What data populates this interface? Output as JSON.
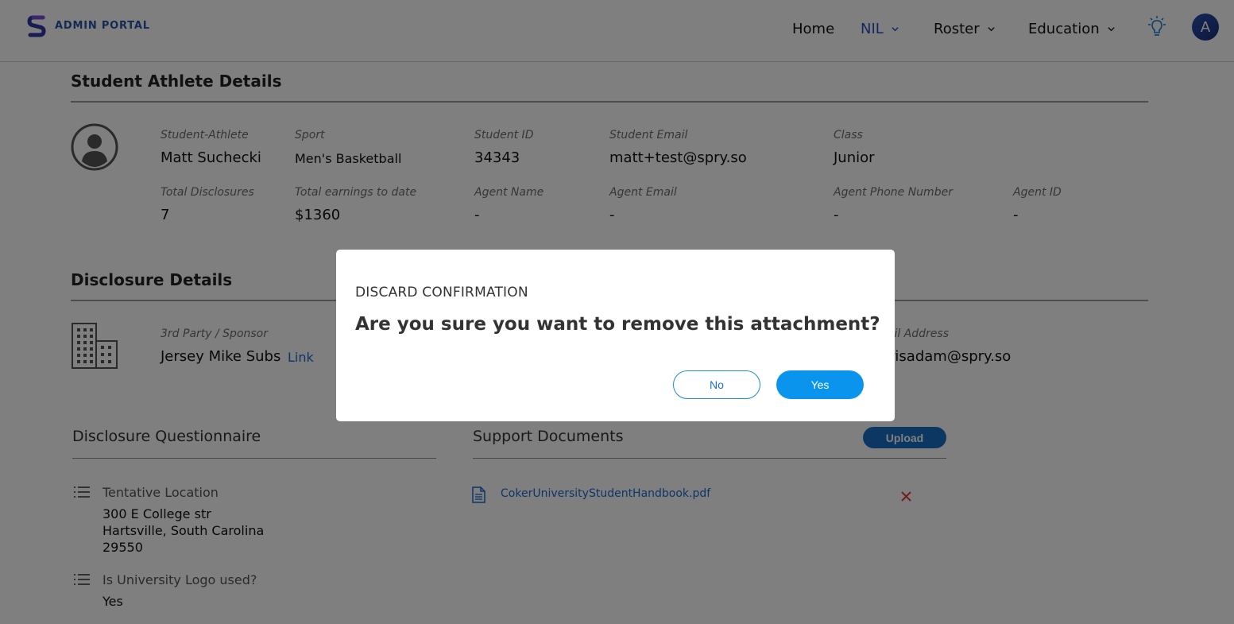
{
  "header": {
    "brand": "ADMIN PORTAL",
    "nav": [
      {
        "label": "Home",
        "has_dropdown": false,
        "active": false
      },
      {
        "label": "NIL",
        "has_dropdown": true,
        "active": true
      },
      {
        "label": "Roster",
        "has_dropdown": true,
        "active": false
      },
      {
        "label": "Education",
        "has_dropdown": true,
        "active": false
      }
    ],
    "avatar_initial": "A",
    "icons": {
      "bulb": "lightbulb-icon",
      "logo": "spry-logo-icon"
    }
  },
  "athlete": {
    "title": "Student Athlete Details",
    "fields": [
      {
        "label": "Student-Athlete",
        "value": "Matt Suchecki"
      },
      {
        "label": "Sport",
        "value": "Men's Basketball"
      },
      {
        "label": "Student ID",
        "value": "34343"
      },
      {
        "label": "Student Email",
        "value": "matt+test@spry.so"
      },
      {
        "label": "Class",
        "value": "Junior"
      },
      {
        "label": "Total Disclosures",
        "value": "7"
      },
      {
        "label": "Total earnings to date",
        "value": "$1360"
      },
      {
        "label": "Agent Name",
        "value": "-"
      },
      {
        "label": "Agent Email",
        "value": "-"
      },
      {
        "label": "Agent Phone Number",
        "value": "-"
      },
      {
        "label": "Agent ID",
        "value": "-"
      }
    ]
  },
  "disclosure": {
    "title": "Disclosure Details",
    "sponsor_label": "3rd Party / Sponsor",
    "sponsor_value": "Jersey Mike Subs",
    "sponsor_link": "Link",
    "email_label_partial": "nail Address",
    "email_value_partial": "arisadam@spry.so"
  },
  "questionnaire": {
    "title": "Disclosure Questionnaire",
    "items": [
      {
        "question": "Tentative Location",
        "answer_lines": [
          "300 E College str",
          "Hartsville, South Carolina",
          "29550"
        ]
      },
      {
        "question": "Is University Logo used?",
        "answer_lines": [
          "Yes"
        ]
      }
    ]
  },
  "support_docs": {
    "title": "Support Documents",
    "upload_label": "Upload",
    "files": [
      {
        "name": "CokerUniversityStudentHandbook.pdf"
      }
    ]
  },
  "modal": {
    "kicker": "DISCARD CONFIRMATION",
    "question": "Are you sure you want to remove this attachment?",
    "no_label": "No",
    "yes_label": "Yes"
  },
  "colors": {
    "accent": "#0b94ee",
    "brand": "#2b55a8",
    "remove": "#e03a3a"
  }
}
